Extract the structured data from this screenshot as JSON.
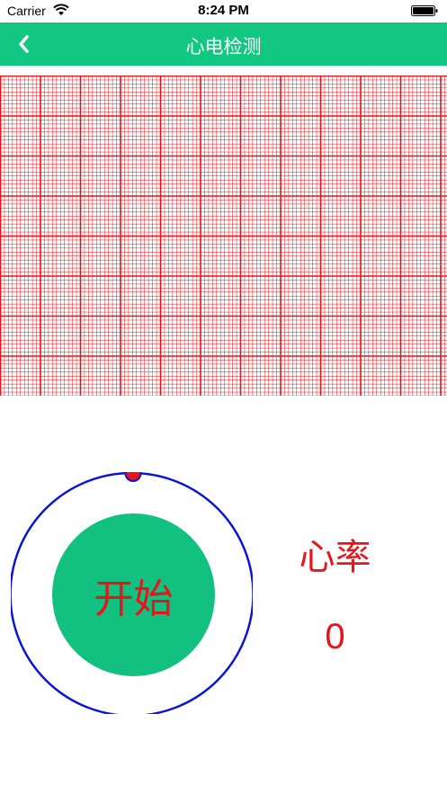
{
  "status_bar": {
    "carrier": "Carrier",
    "time": "8:24 PM"
  },
  "nav": {
    "title": "心电检测",
    "back_icon": "chevron-left-icon"
  },
  "ecg_grid": {
    "grid_color": "#e8141b"
  },
  "monitor": {
    "start_label": "开始",
    "heart_rate_label": "心率",
    "heart_rate_value": "0",
    "ring_color": "#0a14d8",
    "indicator_color": "#e8141b",
    "button_color": "#12c07f"
  },
  "colors": {
    "nav_background": "#12c782",
    "text_accent": "#e8141b"
  }
}
